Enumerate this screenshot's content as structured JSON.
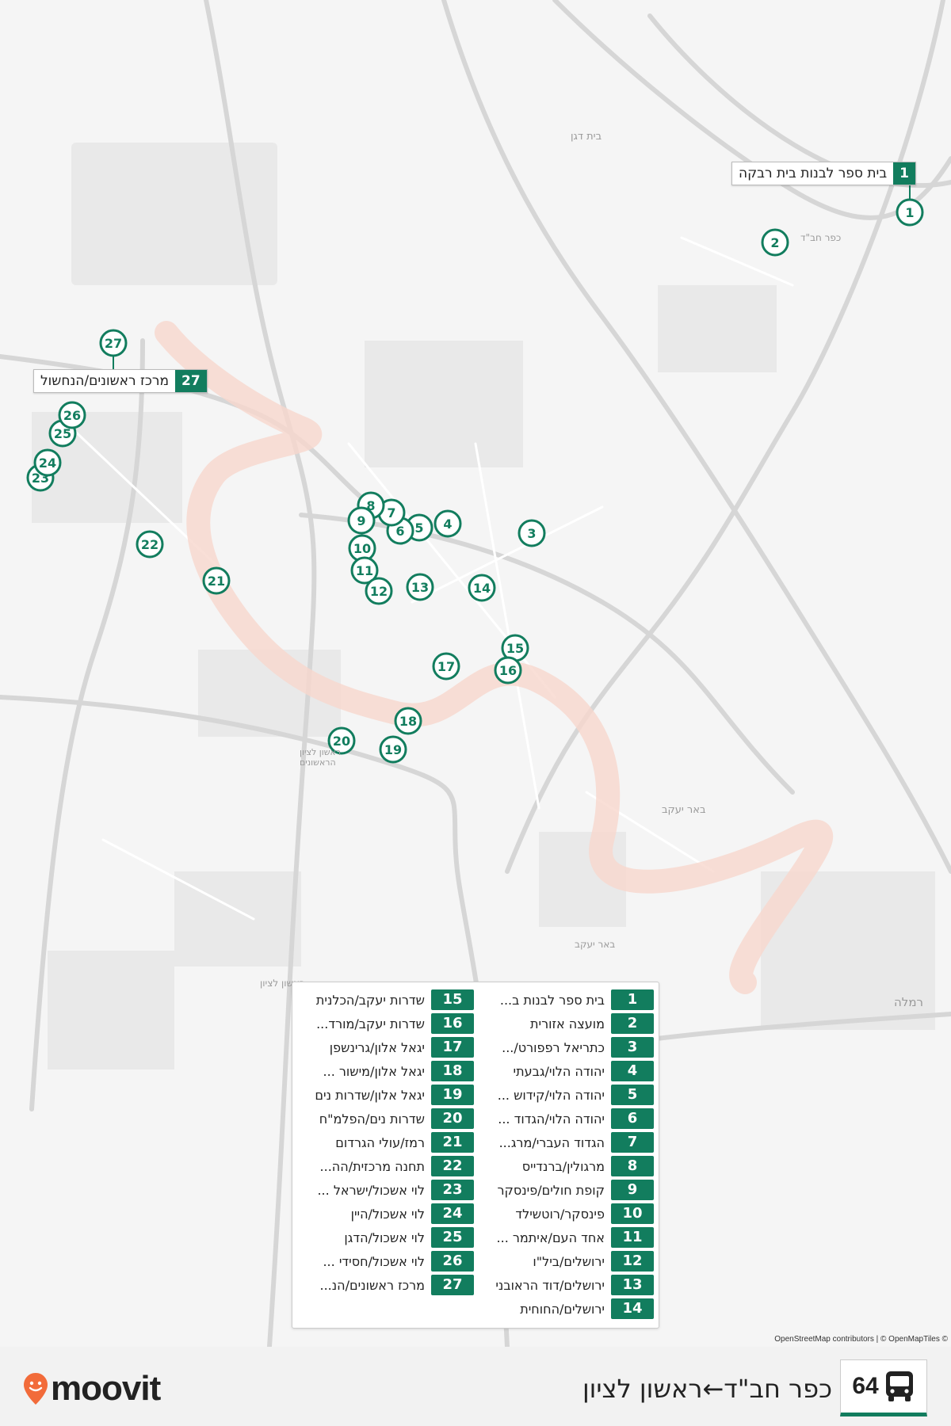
{
  "header": {
    "route_number": "64",
    "route_title": "כפר חב\"ד←ראשון לציון",
    "bus_icon": "bus-icon"
  },
  "brand": {
    "name": "moovit",
    "logo_icon": "moovit-pin-icon",
    "brand_color": "#f26b3a",
    "accent": "#127d5e"
  },
  "map_labels": {
    "beit_dagan": "בית דגן",
    "kfar_chabad": "כפר חב\"ד",
    "beer_yaakov_1": "באר יעקב",
    "beer_yaakov_2": "באר יעקב",
    "rishon_station": "ראשון לציון הראשונים",
    "rishon": "ראשון לציון",
    "ramla": "רמלה"
  },
  "callouts": {
    "first": {
      "num": "1",
      "text": "בית ספר לבנות בית רבקה"
    },
    "last": {
      "num": "27",
      "text": "מרכז ראשונים/הנחשול"
    }
  },
  "markers": [
    "1",
    "2",
    "3",
    "4",
    "5",
    "6",
    "7",
    "8",
    "9",
    "10",
    "11",
    "12",
    "13",
    "14",
    "15",
    "16",
    "17",
    "18",
    "19",
    "20",
    "21",
    "22",
    "23",
    "24",
    "25",
    "26",
    "27"
  ],
  "stops": [
    {
      "num": "1",
      "name": "בית ספר לבנות ב..."
    },
    {
      "num": "2",
      "name": "מועצה אזורית"
    },
    {
      "num": "3",
      "name": "כתריאל רפפורט/..."
    },
    {
      "num": "4",
      "name": "יהודה הלוי/גבעתי"
    },
    {
      "num": "5",
      "name": "יהודה הלוי/קידוש ..."
    },
    {
      "num": "6",
      "name": "יהודה הלוי/הגדוד ..."
    },
    {
      "num": "7",
      "name": "הגדוד העברי/מרג..."
    },
    {
      "num": "8",
      "name": "מרגולין/ברנדייס"
    },
    {
      "num": "9",
      "name": "קופת חולים/פינסקר"
    },
    {
      "num": "10",
      "name": "פינסקר/רוטשילד"
    },
    {
      "num": "11",
      "name": "אחד העם/איתמר ..."
    },
    {
      "num": "12",
      "name": "ירושלים/ביל\"ו"
    },
    {
      "num": "13",
      "name": "ירושלים/דוד הראובני"
    },
    {
      "num": "14",
      "name": "ירושלים/החוחית"
    },
    {
      "num": "15",
      "name": "שדרות יעקב/הכלנית"
    },
    {
      "num": "16",
      "name": "שדרות יעקב/מורד..."
    },
    {
      "num": "17",
      "name": "יגאל אלון/גרינשפן"
    },
    {
      "num": "18",
      "name": "יגאל אלון/מישור ..."
    },
    {
      "num": "19",
      "name": "יגאל אלון/שדרות נים"
    },
    {
      "num": "20",
      "name": "שדרות נים/הפלמ\"ח"
    },
    {
      "num": "21",
      "name": "רמז/עולי הגרדום"
    },
    {
      "num": "22",
      "name": "תחנה מרכזית/הה..."
    },
    {
      "num": "23",
      "name": "לוי אשכול/ישראל ..."
    },
    {
      "num": "24",
      "name": "לוי אשכול/היין"
    },
    {
      "num": "25",
      "name": "לוי אשכול/הדגן"
    },
    {
      "num": "26",
      "name": "לוי אשכול/חסידי ..."
    },
    {
      "num": "27",
      "name": "מרכז ראשונים/הנ..."
    }
  ],
  "attribution": "OpenStreetMap contributors | © OpenMapTiles ©"
}
